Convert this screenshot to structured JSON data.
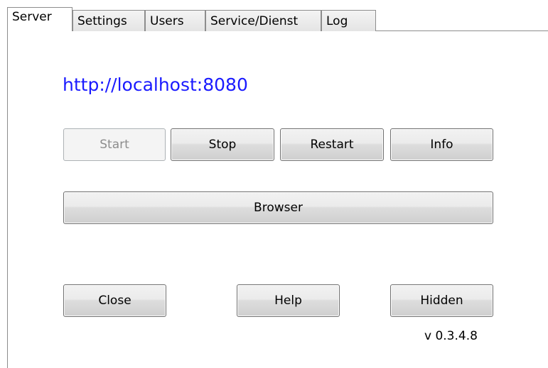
{
  "tabs": [
    {
      "label": "Server",
      "active": true
    },
    {
      "label": "Settings",
      "active": false
    },
    {
      "label": "Users",
      "active": false
    },
    {
      "label": "Service/Dienst",
      "active": false
    },
    {
      "label": "Log",
      "active": false
    }
  ],
  "server": {
    "url": "http://localhost:8080",
    "url_color": "#1a1aff",
    "buttons": {
      "start": {
        "label": "Start",
        "enabled": false
      },
      "stop": {
        "label": "Stop",
        "enabled": true
      },
      "restart": {
        "label": "Restart",
        "enabled": true
      },
      "info": {
        "label": "Info",
        "enabled": true
      },
      "browser": {
        "label": "Browser",
        "enabled": true
      },
      "close": {
        "label": "Close",
        "enabled": true
      },
      "help": {
        "label": "Help",
        "enabled": true
      },
      "hidden": {
        "label": "Hidden",
        "enabled": true
      }
    },
    "version": "v 0.3.4.8"
  }
}
